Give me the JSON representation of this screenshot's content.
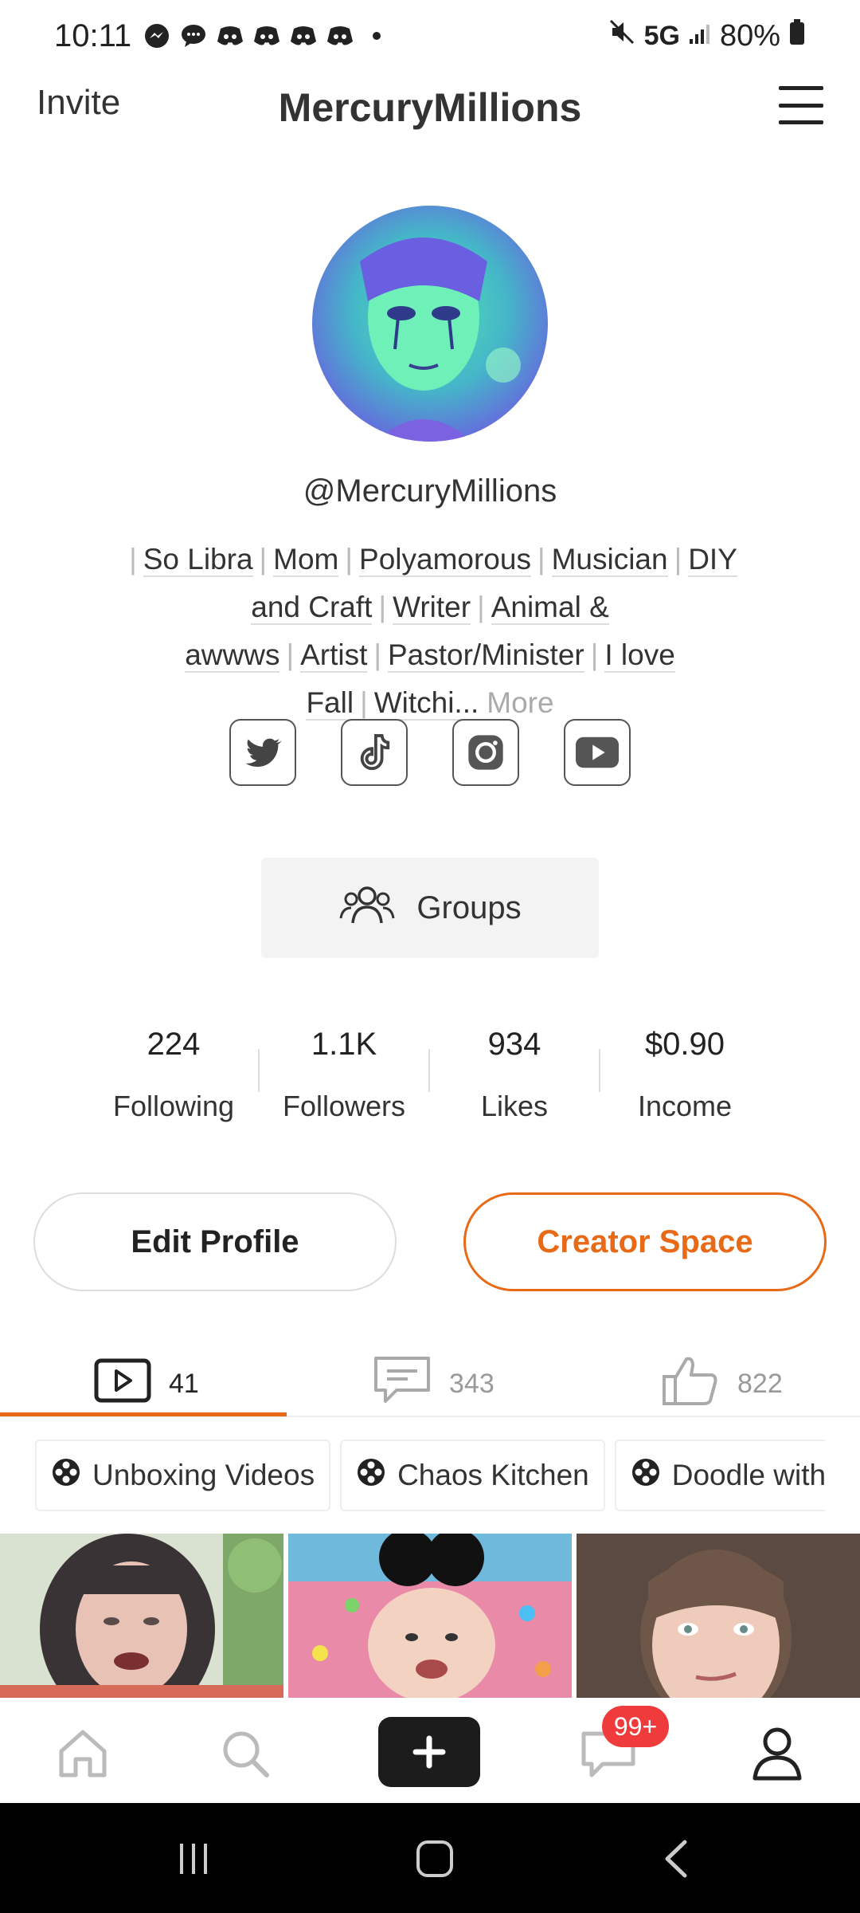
{
  "status_bar": {
    "time": "10:11",
    "notification_icons": [
      "messenger-icon",
      "chat-icon",
      "discord-icon",
      "discord-icon",
      "discord-icon",
      "discord-icon",
      "dot-icon"
    ],
    "network": "5G",
    "battery": "80%"
  },
  "header": {
    "invite_label": "Invite",
    "title": "MercuryMillions"
  },
  "profile": {
    "handle": "@MercuryMillions",
    "bio_tags": [
      "So Libra",
      "Mom",
      "Polyamorous",
      "Musician",
      "DIY and Craft",
      "Writer",
      "Animal & awwws",
      "Artist",
      "Pastor/Minister",
      "I love Fall",
      "Witchi..."
    ],
    "bio_more": "More",
    "socials": [
      "twitter-icon",
      "tiktok-icon",
      "instagram-icon",
      "youtube-icon"
    ],
    "groups_label": "Groups"
  },
  "stats": [
    {
      "value": "224",
      "label": "Following"
    },
    {
      "value": "1.1K",
      "label": "Followers"
    },
    {
      "value": "934",
      "label": "Likes"
    },
    {
      "value": "$0.90",
      "label": "Income"
    }
  ],
  "actions": {
    "edit_profile": "Edit Profile",
    "creator_space": "Creator Space"
  },
  "content_tabs": [
    {
      "icon": "video-icon",
      "count": "41"
    },
    {
      "icon": "comment-icon",
      "count": "343"
    },
    {
      "icon": "thumbs-up-icon",
      "count": "822"
    }
  ],
  "playlists": [
    "Unboxing Videos",
    "Chaos Kitchen",
    "Doodle with m"
  ],
  "bottom_nav": {
    "items": [
      "home-icon",
      "search-icon",
      "plus-icon",
      "messages-icon",
      "profile-icon"
    ],
    "messages_badge": "99+"
  },
  "colors": {
    "accent": "#e86a16",
    "badge": "#ef3b3b"
  }
}
